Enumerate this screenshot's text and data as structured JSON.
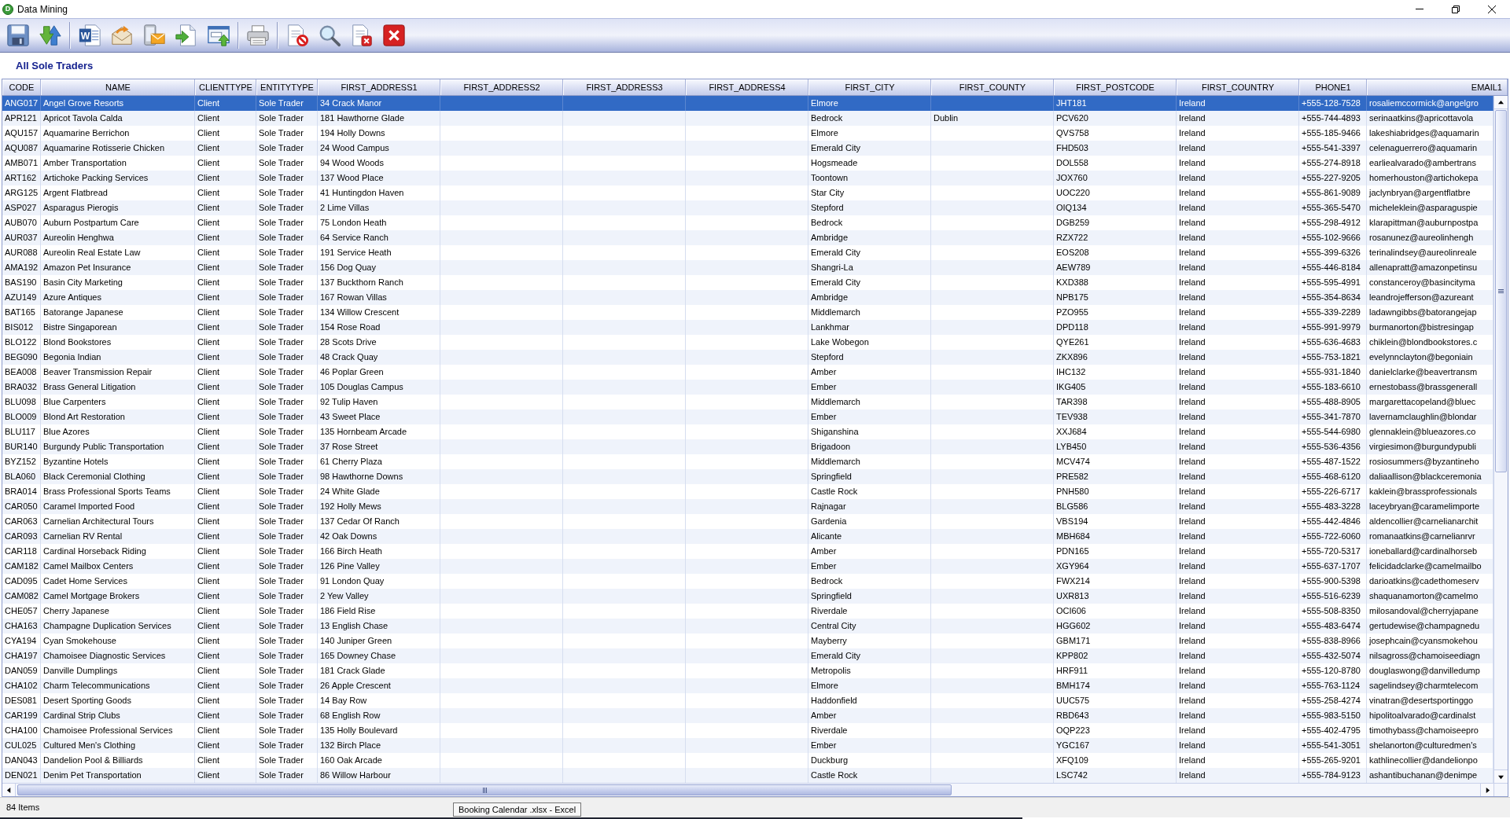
{
  "window": {
    "title": "Data Mining",
    "icon_letter": "D"
  },
  "toolbar": {
    "document_letter": "W"
  },
  "view_title": "All Sole Traders",
  "table": {
    "columns": [
      "CODE",
      "NAME",
      "CLIENTTYPE",
      "ENTITYTYPE",
      "FIRST_ADDRESS1",
      "FIRST_ADDRESS2",
      "FIRST_ADDRESS3",
      "FIRST_ADDRESS4",
      "FIRST_CITY",
      "FIRST_COUNTY",
      "FIRST_POSTCODE",
      "FIRST_COUNTRY",
      "PHONE1",
      "EMAIL1"
    ],
    "rows": [
      {
        "selected": true,
        "code": "ANG017",
        "name": "Angel Grove Resorts",
        "client_type": "Client",
        "entity_type": "Sole Trader",
        "first_address1": "34 Crack Manor",
        "first_city": "Elmore",
        "first_postcode": "JHT181",
        "first_country": "Ireland",
        "phone1": "+555-128-7528",
        "email1": "rosaliemccormick@angelgro"
      },
      {
        "selected": false,
        "code": "APR121",
        "name": "Apricot Tavola Calda",
        "client_type": "Client",
        "entity_type": "Sole Trader",
        "first_address1": "181 Hawthorne Glade",
        "first_city": "Bedrock",
        "first_county": "Dublin",
        "first_postcode": "PCV620",
        "first_country": "Ireland",
        "phone1": "+555-744-4893",
        "email1": "serinaatkins@apricottavola"
      },
      {
        "selected": false,
        "code": "AQU157",
        "name": "Aquamarine Berrichon",
        "client_type": "Client",
        "entity_type": "Sole Trader",
        "first_address1": "194 Holly Downs",
        "first_city": "Elmore",
        "first_postcode": "QVS758",
        "first_country": "Ireland",
        "phone1": "+555-185-9466",
        "email1": "lakeshiabridges@aquamarin"
      },
      {
        "selected": false,
        "code": "AQU087",
        "name": "Aquamarine Rotisserie Chicken",
        "client_type": "Client",
        "entity_type": "Sole Trader",
        "first_address1": "24 Wood Campus",
        "first_city": "Emerald City",
        "first_postcode": "FHD503",
        "first_country": "Ireland",
        "phone1": "+555-541-3397",
        "email1": "celenaguerrero@aquamarin"
      },
      {
        "selected": false,
        "code": "AMB071",
        "name": "Amber Transportation",
        "client_type": "Client",
        "entity_type": "Sole Trader",
        "first_address1": "94 Wood Woods",
        "first_city": "Hogsmeade",
        "first_postcode": "DOL558",
        "first_country": "Ireland",
        "phone1": "+555-274-8918",
        "email1": "earliealvarado@ambertrans"
      },
      {
        "selected": false,
        "code": "ART162",
        "name": "Artichoke Packing Services",
        "client_type": "Client",
        "entity_type": "Sole Trader",
        "first_address1": "137 Wood Place",
        "first_city": "Toontown",
        "first_postcode": "JOX760",
        "first_country": "Ireland",
        "phone1": "+555-227-9205",
        "email1": "homerhouston@artichokepa"
      },
      {
        "selected": false,
        "code": "ARG125",
        "name": "Argent Flatbread",
        "client_type": "Client",
        "entity_type": "Sole Trader",
        "first_address1": "41 Huntingdon Haven",
        "first_city": "Star City",
        "first_postcode": "UOC220",
        "first_country": "Ireland",
        "phone1": "+555-861-9089",
        "email1": "jaclynbryan@argentflatbre"
      },
      {
        "selected": false,
        "code": "ASP027",
        "name": "Asparagus Pierogis",
        "client_type": "Client",
        "entity_type": "Sole Trader",
        "first_address1": "2 Lime Villas",
        "first_city": "Stepford",
        "first_postcode": "OIQ134",
        "first_country": "Ireland",
        "phone1": "+555-365-5470",
        "email1": "micheleklein@asparaguspie"
      },
      {
        "selected": false,
        "code": "AUB070",
        "name": "Auburn Postpartum Care",
        "client_type": "Client",
        "entity_type": "Sole Trader",
        "first_address1": "75 London Heath",
        "first_city": "Bedrock",
        "first_postcode": "DGB259",
        "first_country": "Ireland",
        "phone1": "+555-298-4912",
        "email1": "klarapittman@auburnpostpa"
      },
      {
        "selected": false,
        "code": "AUR037",
        "name": "Aureolin Henghwa",
        "client_type": "Client",
        "entity_type": "Sole Trader",
        "first_address1": "64 Service Ranch",
        "first_city": "Ambridge",
        "first_postcode": "RZX722",
        "first_country": "Ireland",
        "phone1": "+555-102-9666",
        "email1": "rosanunez@aureolinhengh"
      },
      {
        "selected": false,
        "code": "AUR088",
        "name": "Aureolin Real Estate Law",
        "client_type": "Client",
        "entity_type": "Sole Trader",
        "first_address1": "191 Service Heath",
        "first_city": "Emerald City",
        "first_postcode": "EOS208",
        "first_country": "Ireland",
        "phone1": "+555-399-6326",
        "email1": "terinalindsey@aureolinreale"
      },
      {
        "selected": false,
        "code": "AMA192",
        "name": "Amazon Pet Insurance",
        "client_type": "Client",
        "entity_type": "Sole Trader",
        "first_address1": "156 Dog Quay",
        "first_city": "Shangri-La",
        "first_postcode": "AEW789",
        "first_country": "Ireland",
        "phone1": "+555-446-8184",
        "email1": "allenapratt@amazonpetinsu"
      },
      {
        "selected": false,
        "code": "BAS190",
        "name": "Basin City Marketing",
        "client_type": "Client",
        "entity_type": "Sole Trader",
        "first_address1": "137 Buckthorn Ranch",
        "first_city": "Emerald City",
        "first_postcode": "KXD388",
        "first_country": "Ireland",
        "phone1": "+555-595-4991",
        "email1": "constanceroy@basincityma"
      },
      {
        "selected": false,
        "code": "AZU149",
        "name": "Azure Antiques",
        "client_type": "Client",
        "entity_type": "Sole Trader",
        "first_address1": "167 Rowan Villas",
        "first_city": "Ambridge",
        "first_postcode": "NPB175",
        "first_country": "Ireland",
        "phone1": "+555-354-8634",
        "email1": "leandrojefferson@azureant"
      },
      {
        "selected": false,
        "code": "BAT165",
        "name": "Batorange Japanese",
        "client_type": "Client",
        "entity_type": "Sole Trader",
        "first_address1": "134 Willow Crescent",
        "first_city": "Middlemarch",
        "first_postcode": "PZO955",
        "first_country": "Ireland",
        "phone1": "+555-339-2289",
        "email1": "ladawngibbs@batorangejap"
      },
      {
        "selected": false,
        "code": "BIS012",
        "name": "Bistre Singaporean",
        "client_type": "Client",
        "entity_type": "Sole Trader",
        "first_address1": "154 Rose Road",
        "first_city": "Lankhmar",
        "first_postcode": "DPD118",
        "first_country": "Ireland",
        "phone1": "+555-991-9979",
        "email1": "burmanorton@bistresingap"
      },
      {
        "selected": false,
        "code": "BLO122",
        "name": "Blond Bookstores",
        "client_type": "Client",
        "entity_type": "Sole Trader",
        "first_address1": "28 Scots Drive",
        "first_city": "Lake Wobegon",
        "first_postcode": "QYE261",
        "first_country": "Ireland",
        "phone1": "+555-636-4683",
        "email1": "chiklein@blondbookstores.c"
      },
      {
        "selected": false,
        "code": "BEG090",
        "name": "Begonia Indian",
        "client_type": "Client",
        "entity_type": "Sole Trader",
        "first_address1": "48 Crack Quay",
        "first_city": "Stepford",
        "first_postcode": "ZKX896",
        "first_country": "Ireland",
        "phone1": "+555-753-1821",
        "email1": "evelynnclayton@begoniain"
      },
      {
        "selected": false,
        "code": "BEA008",
        "name": "Beaver Transmission Repair",
        "client_type": "Client",
        "entity_type": "Sole Trader",
        "first_address1": "46 Poplar Green",
        "first_city": "Amber",
        "first_postcode": "IHC132",
        "first_country": "Ireland",
        "phone1": "+555-931-1840",
        "email1": "danielclarke@beavertransm"
      },
      {
        "selected": false,
        "code": "BRA032",
        "name": "Brass General Litigation",
        "client_type": "Client",
        "entity_type": "Sole Trader",
        "first_address1": "105 Douglas Campus",
        "first_city": "Ember",
        "first_postcode": "IKG405",
        "first_country": "Ireland",
        "phone1": "+555-183-6610",
        "email1": "ernestobass@brassgenerall"
      },
      {
        "selected": false,
        "code": "BLU098",
        "name": "Blue Carpenters",
        "client_type": "Client",
        "entity_type": "Sole Trader",
        "first_address1": "92 Tulip Haven",
        "first_city": "Middlemarch",
        "first_postcode": "TAR398",
        "first_country": "Ireland",
        "phone1": "+555-488-8905",
        "email1": "margarettacopeland@bluec"
      },
      {
        "selected": false,
        "code": "BLO009",
        "name": "Blond Art Restoration",
        "client_type": "Client",
        "entity_type": "Sole Trader",
        "first_address1": "43 Sweet Place",
        "first_city": "Ember",
        "first_postcode": "TEV938",
        "first_country": "Ireland",
        "phone1": "+555-341-7870",
        "email1": "lavernamclaughlin@blondar"
      },
      {
        "selected": false,
        "code": "BLU117",
        "name": "Blue Azores",
        "client_type": "Client",
        "entity_type": "Sole Trader",
        "first_address1": "135 Hornbeam Arcade",
        "first_city": "Shiganshina",
        "first_postcode": "XXJ684",
        "first_country": "Ireland",
        "phone1": "+555-544-6980",
        "email1": "glennaklein@blueazores.co"
      },
      {
        "selected": false,
        "code": "BUR140",
        "name": "Burgundy Public Transportation",
        "client_type": "Client",
        "entity_type": "Sole Trader",
        "first_address1": "37 Rose Street",
        "first_city": "Brigadoon",
        "first_postcode": "LYB450",
        "first_country": "Ireland",
        "phone1": "+555-536-4356",
        "email1": "virgiesimon@burgundypubli"
      },
      {
        "selected": false,
        "code": "BYZ152",
        "name": "Byzantine Hotels",
        "client_type": "Client",
        "entity_type": "Sole Trader",
        "first_address1": "61 Cherry Plaza",
        "first_city": "Middlemarch",
        "first_postcode": "MCV474",
        "first_country": "Ireland",
        "phone1": "+555-487-1522",
        "email1": "rosiosummers@byzantineho"
      },
      {
        "selected": false,
        "code": "BLA060",
        "name": "Black Ceremonial Clothing",
        "client_type": "Client",
        "entity_type": "Sole Trader",
        "first_address1": "98 Hawthorne Downs",
        "first_city": "Springfield",
        "first_postcode": "PRE582",
        "first_country": "Ireland",
        "phone1": "+555-468-6120",
        "email1": "daliaallison@blackceremonia"
      },
      {
        "selected": false,
        "code": "BRA014",
        "name": "Brass Professional Sports Teams",
        "client_type": "Client",
        "entity_type": "Sole Trader",
        "first_address1": "24 White Glade",
        "first_city": "Castle Rock",
        "first_postcode": "PNH580",
        "first_country": "Ireland",
        "phone1": "+555-226-6717",
        "email1": "kaklein@brassprofessionals"
      },
      {
        "selected": false,
        "code": "CAR050",
        "name": "Caramel Imported Food",
        "client_type": "Client",
        "entity_type": "Sole Trader",
        "first_address1": "192 Holly Mews",
        "first_city": "Rajnagar",
        "first_postcode": "BLG586",
        "first_country": "Ireland",
        "phone1": "+555-483-3228",
        "email1": "laceybryan@caramelimporte"
      },
      {
        "selected": false,
        "code": "CAR063",
        "name": "Carnelian Architectural Tours",
        "client_type": "Client",
        "entity_type": "Sole Trader",
        "first_address1": "137 Cedar Of Ranch",
        "first_city": "Gardenia",
        "first_postcode": "VBS194",
        "first_country": "Ireland",
        "phone1": "+555-442-4846",
        "email1": "aldencollier@carnelianarchit"
      },
      {
        "selected": false,
        "code": "CAR093",
        "name": "Carnelian RV Rental",
        "client_type": "Client",
        "entity_type": "Sole Trader",
        "first_address1": "42 Oak Downs",
        "first_city": "Alicante",
        "first_postcode": "MBH684",
        "first_country": "Ireland",
        "phone1": "+555-722-6060",
        "email1": "romanaatkins@carnelianrvr"
      },
      {
        "selected": false,
        "code": "CAR118",
        "name": "Cardinal Horseback Riding",
        "client_type": "Client",
        "entity_type": "Sole Trader",
        "first_address1": "166 Birch Heath",
        "first_city": "Amber",
        "first_postcode": "PDN165",
        "first_country": "Ireland",
        "phone1": "+555-720-5317",
        "email1": "ioneballard@cardinalhorseb"
      },
      {
        "selected": false,
        "code": "CAM182",
        "name": "Camel Mailbox Centers",
        "client_type": "Client",
        "entity_type": "Sole Trader",
        "first_address1": "126 Pine Valley",
        "first_city": "Ember",
        "first_postcode": "XGY964",
        "first_country": "Ireland",
        "phone1": "+555-637-1707",
        "email1": "felicidadclarke@camelmailbo"
      },
      {
        "selected": false,
        "code": "CAD095",
        "name": "Cadet Home Services",
        "client_type": "Client",
        "entity_type": "Sole Trader",
        "first_address1": "91 London Quay",
        "first_city": "Bedrock",
        "first_postcode": "FWX214",
        "first_country": "Ireland",
        "phone1": "+555-900-5398",
        "email1": "darioatkins@cadethomeserv"
      },
      {
        "selected": false,
        "code": "CAM082",
        "name": "Camel Mortgage Brokers",
        "client_type": "Client",
        "entity_type": "Sole Trader",
        "first_address1": "2 Yew Valley",
        "first_city": "Springfield",
        "first_postcode": "UXR813",
        "first_country": "Ireland",
        "phone1": "+555-516-6239",
        "email1": "shaquanamorton@camelmo"
      },
      {
        "selected": false,
        "code": "CHE057",
        "name": "Cherry Japanese",
        "client_type": "Client",
        "entity_type": "Sole Trader",
        "first_address1": "186 Field Rise",
        "first_city": "Riverdale",
        "first_postcode": "OCI606",
        "first_country": "Ireland",
        "phone1": "+555-508-8350",
        "email1": "milosandoval@cherryjapane"
      },
      {
        "selected": false,
        "code": "CHA163",
        "name": "Champagne Duplication Services",
        "client_type": "Client",
        "entity_type": "Sole Trader",
        "first_address1": "13 English Chase",
        "first_city": "Central City",
        "first_postcode": "HGG602",
        "first_country": "Ireland",
        "phone1": "+555-483-6474",
        "email1": "gertudewise@champagnedu"
      },
      {
        "selected": false,
        "code": "CYA194",
        "name": "Cyan Smokehouse",
        "client_type": "Client",
        "entity_type": "Sole Trader",
        "first_address1": "140 Juniper Green",
        "first_city": "Mayberry",
        "first_postcode": "GBM171",
        "first_country": "Ireland",
        "phone1": "+555-838-8966",
        "email1": "josephcain@cyansmokehou"
      },
      {
        "selected": false,
        "code": "CHA197",
        "name": "Chamoisee Diagnostic Services",
        "client_type": "Client",
        "entity_type": "Sole Trader",
        "first_address1": "165 Downey Chase",
        "first_city": "Emerald City",
        "first_postcode": "KPP802",
        "first_country": "Ireland",
        "phone1": "+555-432-5074",
        "email1": "nilsagross@chamoiseediagn"
      },
      {
        "selected": false,
        "code": "DAN059",
        "name": "Danville Dumplings",
        "client_type": "Client",
        "entity_type": "Sole Trader",
        "first_address1": "181 Crack Glade",
        "first_city": "Metropolis",
        "first_postcode": "HRF911",
        "first_country": "Ireland",
        "phone1": "+555-120-8780",
        "email1": "douglaswong@danvilledump"
      },
      {
        "selected": false,
        "code": "CHA102",
        "name": "Charm Telecommunications",
        "client_type": "Client",
        "entity_type": "Sole Trader",
        "first_address1": "26 Apple Crescent",
        "first_city": "Elmore",
        "first_postcode": "BMH174",
        "first_country": "Ireland",
        "phone1": "+555-763-1124",
        "email1": "sagelindsey@charmtelecom"
      },
      {
        "selected": false,
        "code": "DES081",
        "name": "Desert Sporting Goods",
        "client_type": "Client",
        "entity_type": "Sole Trader",
        "first_address1": "14 Bay Row",
        "first_city": "Haddonfield",
        "first_postcode": "UUC575",
        "first_country": "Ireland",
        "phone1": "+555-258-4274",
        "email1": "vinatran@desertsportinggo"
      },
      {
        "selected": false,
        "code": "CAR199",
        "name": "Cardinal Strip Clubs",
        "client_type": "Client",
        "entity_type": "Sole Trader",
        "first_address1": "68 English Row",
        "first_city": "Amber",
        "first_postcode": "RBD643",
        "first_country": "Ireland",
        "phone1": "+555-983-5150",
        "email1": "hipolitoalvarado@cardinalst"
      },
      {
        "selected": false,
        "code": "CHA100",
        "name": "Chamoisee Professional Services",
        "client_type": "Client",
        "entity_type": "Sole Trader",
        "first_address1": "135 Holly Boulevard",
        "first_city": "Riverdale",
        "first_postcode": "OQP223",
        "first_country": "Ireland",
        "phone1": "+555-402-4795",
        "email1": "timothybass@chamoiseepro"
      },
      {
        "selected": false,
        "code": "CUL025",
        "name": "Cultured Men's Clothing",
        "client_type": "Client",
        "entity_type": "Sole Trader",
        "first_address1": "132 Birch Place",
        "first_city": "Ember",
        "first_postcode": "YGC167",
        "first_country": "Ireland",
        "phone1": "+555-541-3051",
        "email1": "shelanorton@culturedmen's"
      },
      {
        "selected": false,
        "code": "DAN043",
        "name": "Dandelion Pool & Billiards",
        "client_type": "Client",
        "entity_type": "Sole Trader",
        "first_address1": "160 Oak Arcade",
        "first_city": "Duckburg",
        "first_postcode": "XFQ109",
        "first_country": "Ireland",
        "phone1": "+555-265-9201",
        "email1": "kathlinecollier@dandelionpo"
      },
      {
        "selected": false,
        "code": "DEN021",
        "name": "Denim Pet Transportation",
        "client_type": "Client",
        "entity_type": "Sole Trader",
        "first_address1": "86 Willow Harbour",
        "first_city": "Castle Rock",
        "first_postcode": "LSC742",
        "first_country": "Ireland",
        "phone1": "+555-784-9123",
        "email1": "ashantibuchanan@denimpe"
      }
    ]
  },
  "status_bar": {
    "item_count": "84 Items"
  },
  "taskbar_tooltip": "Booking Calendar .xlsx - Excel"
}
